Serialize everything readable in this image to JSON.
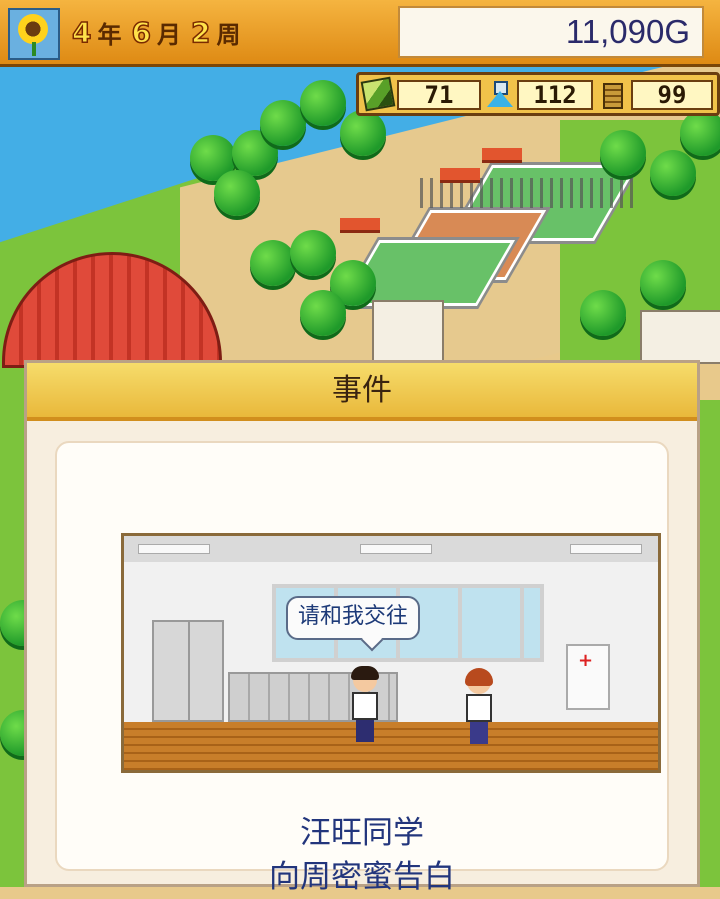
{
  "topbar": {
    "year": "4",
    "year_unit": "年",
    "month": "6",
    "month_unit": "月",
    "week": "2",
    "week_unit": "周",
    "money": "11,090G"
  },
  "stats": {
    "pencil_value": "71",
    "flask_value": "112",
    "tower_value": "99"
  },
  "event": {
    "title": "事件",
    "speech": "请和我交往",
    "line1": "汪旺同学",
    "line2": "向周密蜜告白"
  },
  "colors": {
    "topbar": "#de8a14",
    "panel_header": "#e9b83b",
    "event_text": "#22357c"
  }
}
